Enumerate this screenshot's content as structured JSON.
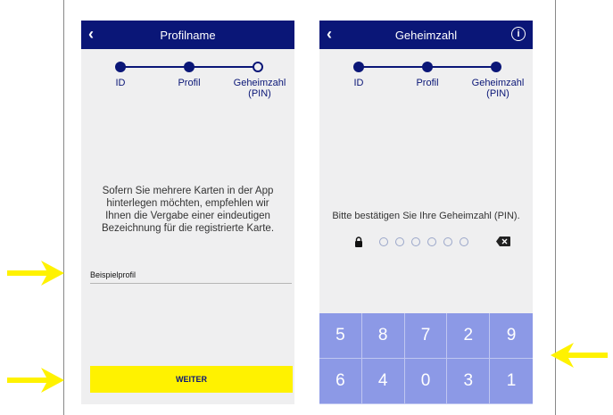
{
  "left_screen": {
    "back_icon": "chevron-left-icon",
    "title": "Profilname",
    "steps": [
      "ID",
      "Profil",
      "Geheimzahl\n(PIN)"
    ],
    "info_text": "Sofern Sie mehrere Karten in der App hinterlegen möchten, empfehlen wir Ihnen die Vergabe einer eindeutigen Bezeichnung für die registrierte Karte.",
    "profile_name_value": "Beispielprofil",
    "continue_label": "WEITER"
  },
  "right_screen": {
    "back_icon": "chevron-left-icon",
    "title": "Geheimzahl",
    "info_icon_label": "i",
    "steps": [
      "ID",
      "Profil",
      "Geheimzahl\n(PIN)"
    ],
    "prompt": "Bitte bestätigen Sie Ihre Geheimzahl (PIN).",
    "pin_digits_entered": 0,
    "pin_length": 6,
    "keys": [
      "5",
      "8",
      "7",
      "2",
      "9",
      "6",
      "4",
      "0",
      "3",
      "1"
    ]
  },
  "colors": {
    "navbar": "#0a1677",
    "accent_yellow": "#fff200",
    "keypad": "#8c99e6",
    "annotation_arrow": "#fff200"
  }
}
